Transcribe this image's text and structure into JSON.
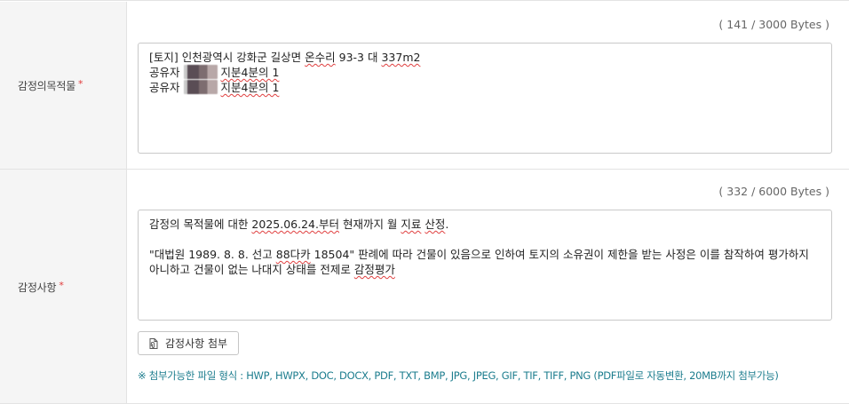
{
  "rows": [
    {
      "label": "감정의목적물",
      "required_mark": "*",
      "byte_count": "( 141 / 3000 Bytes )",
      "text_lines": [
        {
          "segments": [
            {
              "text": "[토지] 인천광역시 강화군 길상면 "
            },
            {
              "text": "온수리",
              "wavy": true
            },
            {
              "text": " 93-3 대 "
            },
            {
              "text": "337m2",
              "wavy": true
            }
          ]
        },
        {
          "prefix": "공유자",
          "suffix": "지분4분의 1"
        },
        {
          "prefix": "공유자",
          "suffix": "지분4분의 1"
        }
      ]
    },
    {
      "label": "감정사항",
      "required_mark": "*",
      "byte_count": "( 332 / 6000 Bytes )",
      "text": {
        "line1_a": "감정의 목적물에 대한 ",
        "line1_b": "2025.06.24.부터",
        "line1_c": " 현재까지 월 ",
        "line1_d": "지료",
        "line1_e": " ",
        "line1_f": "산정",
        "line1_g": ".",
        "line3_a": "\"대법원 1989. 8. 8. 선고 ",
        "line3_b": "88다카",
        "line3_c": " 18504\" 판례에 따라 건물이 있음으로 인하여 토지의 소유권이 제한을 받는 사정은 이를 참작하여 평가하지",
        "line4_a": "아니하고 건물이 없는 나대지 상태를 전제로 ",
        "line4_b": "감정평가"
      },
      "attach_button": "감정사항 첨부",
      "attach_icon": "file-attach-icon",
      "notice": "※ 첨부가능한 파일 형식 : HWP, HWPX, DOC, DOCX, PDF, TXT, BMP, JPG, JPEG, GIF, TIF, TIFF, PNG (PDF파일로 자동변환, 20MB까지 첨부가능)"
    }
  ],
  "colors": {
    "required": "#e03a3a",
    "notice": "#1d7d8e",
    "label_bg": "#f5f5f5",
    "border": "#c9c9c9"
  }
}
